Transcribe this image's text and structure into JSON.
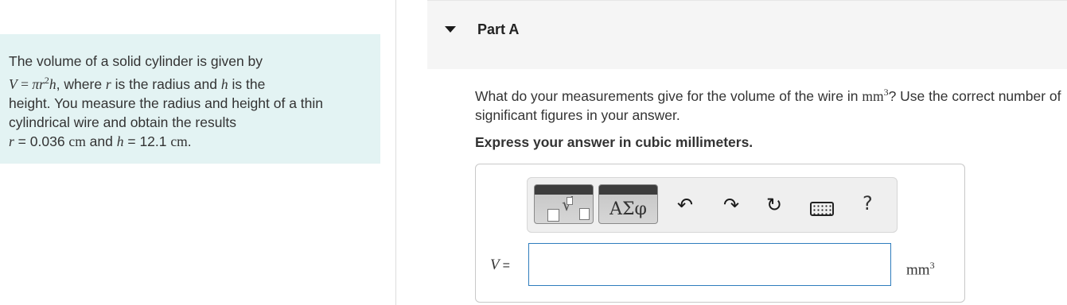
{
  "left_panel": {
    "line1": "The volume of a solid cylinder is given by",
    "formula_V": "V",
    "formula_eq": " = ",
    "formula_pi": "π",
    "formula_r": "r",
    "formula_exp": "2",
    "formula_h": "h",
    "line2_rest": ", where ",
    "var_r": "r",
    "line2_mid": " is the radius and ",
    "var_h": "h",
    "line2_end": " is the",
    "line3": "height. You measure the radius and height of a thin",
    "line4": "cylindrical wire and obtain the results",
    "r_label": "r",
    "r_eq": " = 0.036 ",
    "r_unit": "cm",
    "and": " and ",
    "h_label": "h",
    "h_eq": " = 12.1 ",
    "h_unit": "cm",
    "period": "."
  },
  "part": {
    "title": "Part A"
  },
  "question": {
    "text_before": "What do your measurements give for the volume of the wire in ",
    "unit": "mm",
    "unit_exp": "3",
    "text_after": "? Use the correct number of significant figures in your answer."
  },
  "instruction": "Express your answer in cubic millimeters.",
  "toolbar": {
    "templates_icon": "templates-icon",
    "symbols_label": "ΑΣφ",
    "undo_glyph": "↶",
    "redo_glyph": "↷",
    "reset_glyph": "↻",
    "help_label": "?"
  },
  "answer": {
    "variable": "V",
    "equals": "=",
    "value": "",
    "unit": "mm",
    "unit_exp": "3"
  }
}
